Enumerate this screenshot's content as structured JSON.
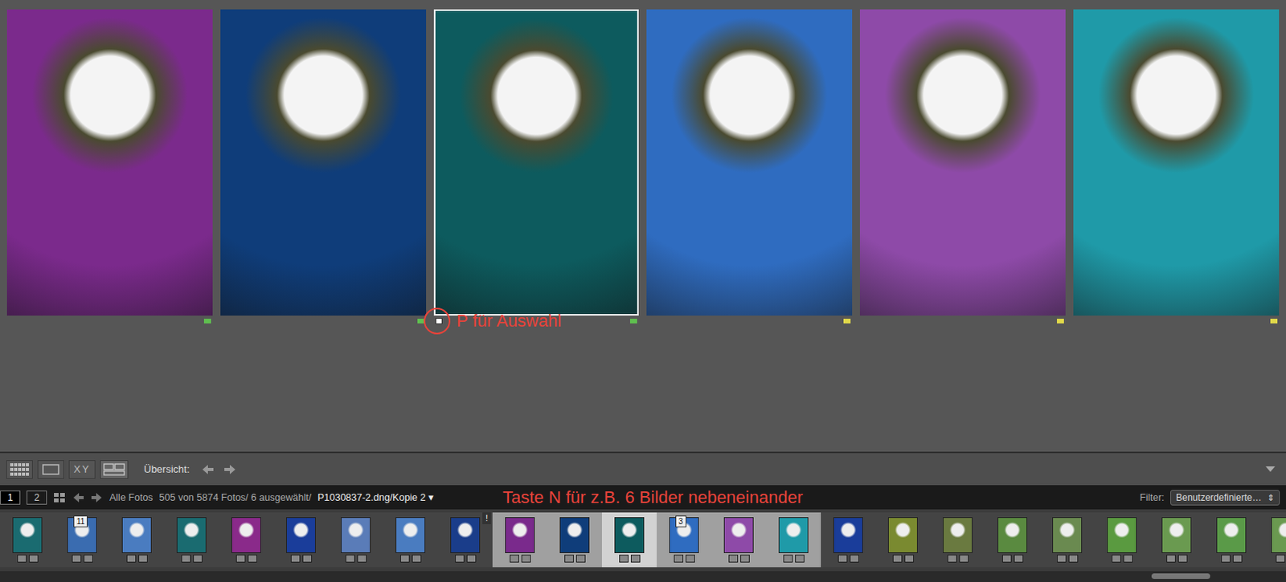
{
  "photos": [
    {
      "color": "#7b2a8c",
      "label_color": "#5fbf4f",
      "selected": false,
      "flagged": false
    },
    {
      "color": "#0f3d7a",
      "label_color": "#5fbf4f",
      "selected": false,
      "flagged": false
    },
    {
      "color": "#0d5b5e",
      "label_color": "#5fbf4f",
      "selected": true,
      "flagged": true
    },
    {
      "color": "#2f6cc0",
      "label_color": "#e0d84a",
      "selected": false,
      "flagged": false
    },
    {
      "color": "#8e4aa8",
      "label_color": "#e0d84a",
      "selected": false,
      "flagged": false
    },
    {
      "color": "#1f9aa8",
      "label_color": "#e0d84a",
      "selected": false,
      "flagged": false
    }
  ],
  "annotations": {
    "pick": "P für Auswahl",
    "count": "Taste N für z.B. 6 Bilder nebeneinander"
  },
  "toolbar": {
    "views": [
      {
        "name": "grid",
        "label": "",
        "selected": false
      },
      {
        "name": "loupe",
        "label": "",
        "selected": false
      },
      {
        "name": "compare",
        "label": "XY",
        "selected": false
      },
      {
        "name": "survey",
        "label": "",
        "selected": true
      }
    ],
    "overview_label": "Übersicht:"
  },
  "filmstrip_bar": {
    "monitors": [
      {
        "label": "1",
        "selected": true
      },
      {
        "label": "2",
        "selected": false
      }
    ],
    "source": "Alle Fotos",
    "count": "505 von 5874 Fotos/ 6 ausgewählt/",
    "file": "P1030837-2.dng/Kopie 2",
    "file_caret": "▾",
    "filter_label": "Filter:",
    "filter_value": "Benutzerdefinierte…",
    "filter_caret": "⇕"
  },
  "thumbnails": [
    {
      "color": "#1a6b70",
      "selected": false,
      "active": false,
      "badge": ""
    },
    {
      "color": "#3a6cb0",
      "selected": false,
      "active": false,
      "badge": "11"
    },
    {
      "color": "#4a7cc0",
      "selected": false,
      "active": false,
      "badge": ""
    },
    {
      "color": "#1a6b70",
      "selected": false,
      "active": false,
      "badge": ""
    },
    {
      "color": "#8a2a8a",
      "selected": false,
      "active": false,
      "badge": ""
    },
    {
      "color": "#1a3d9a",
      "selected": false,
      "active": false,
      "badge": ""
    },
    {
      "color": "#5a7cb8",
      "selected": false,
      "active": false,
      "badge": ""
    },
    {
      "color": "#4a7cc0",
      "selected": false,
      "active": false,
      "badge": ""
    },
    {
      "color": "#1a3d8a",
      "selected": false,
      "active": false,
      "badge": "!"
    },
    {
      "color": "#7a2a8c",
      "selected": true,
      "active": false,
      "badge": ""
    },
    {
      "color": "#0f3d7a",
      "selected": true,
      "active": false,
      "badge": ""
    },
    {
      "color": "#0d5b5e",
      "selected": true,
      "active": true,
      "badge": ""
    },
    {
      "color": "#2f6cc0",
      "selected": true,
      "active": false,
      "badge": "3"
    },
    {
      "color": "#8e4aa8",
      "selected": true,
      "active": false,
      "badge": ""
    },
    {
      "color": "#1f9aa8",
      "selected": true,
      "active": false,
      "badge": ""
    },
    {
      "color": "#1a3d9a",
      "selected": false,
      "active": false,
      "badge": ""
    },
    {
      "color": "#7a8a30",
      "selected": false,
      "active": false,
      "badge": ""
    },
    {
      "color": "#6a7a40",
      "selected": false,
      "active": false,
      "badge": ""
    },
    {
      "color": "#5a8a40",
      "selected": false,
      "active": false,
      "badge": ""
    },
    {
      "color": "#6a8a50",
      "selected": false,
      "active": false,
      "badge": ""
    },
    {
      "color": "#5a9a40",
      "selected": false,
      "active": false,
      "badge": ""
    },
    {
      "color": "#6a9a50",
      "selected": false,
      "active": false,
      "badge": ""
    },
    {
      "color": "#5a9a48",
      "selected": false,
      "active": false,
      "badge": ""
    },
    {
      "color": "#6a9a50",
      "selected": false,
      "active": false,
      "badge": ""
    }
  ]
}
